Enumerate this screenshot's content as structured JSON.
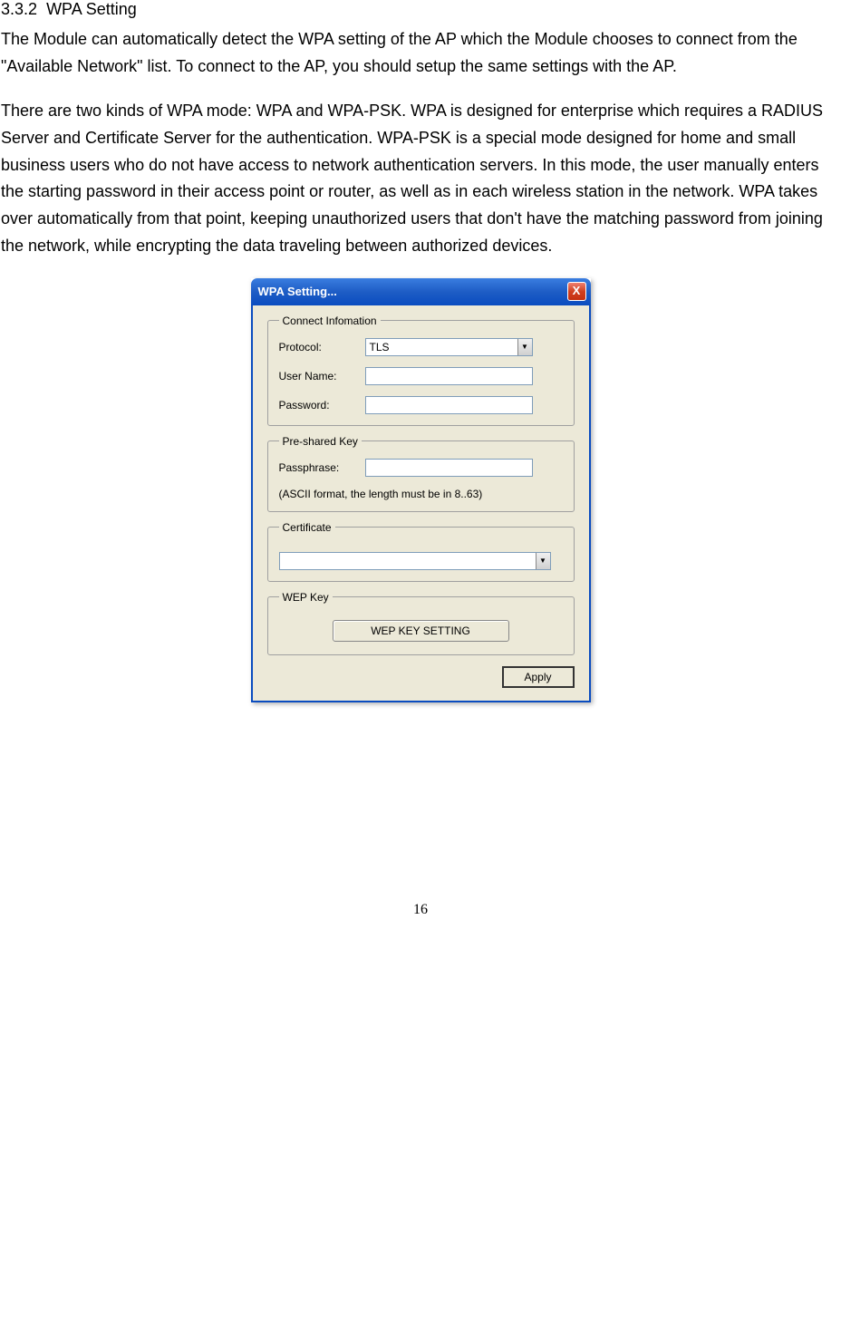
{
  "section": {
    "number": "3.3.2",
    "title": "WPA Setting"
  },
  "paragraphs": {
    "p1": "The Module can automatically detect the WPA setting of the AP which the Module chooses to connect from the \"Available Network\" list. To connect to the AP, you should setup the same settings with the AP.",
    "p2": "There are two kinds of WPA mode: WPA and WPA-PSK. WPA is designed for enterprise which requires a RADIUS Server and Certificate Server for the authentication. WPA-PSK is a special mode designed for home and small business users who do not have access to network authentication servers. In this mode, the user manually enters the starting password in their access point or router, as well as in each wireless station in the network. WPA takes over automatically from that point, keeping unauthorized users that don't have the matching password from joining the network, while encrypting the data traveling between authorized devices."
  },
  "dialog": {
    "title": "WPA Setting...",
    "close": "X",
    "groups": {
      "connect": {
        "legend": "Connect Infomation",
        "protocol_label": "Protocol:",
        "protocol_value": "TLS",
        "username_label": "User Name:",
        "username_value": "",
        "password_label": "Password:",
        "password_value": ""
      },
      "psk": {
        "legend": "Pre-shared Key",
        "passphrase_label": "Passphrase:",
        "passphrase_value": "",
        "hint": "(ASCII format, the length must be in 8..63)"
      },
      "certificate": {
        "legend": "Certificate",
        "value": ""
      },
      "wep": {
        "legend": "WEP Key",
        "button": "WEP KEY SETTING"
      }
    },
    "apply": "Apply"
  },
  "page_number": "16"
}
